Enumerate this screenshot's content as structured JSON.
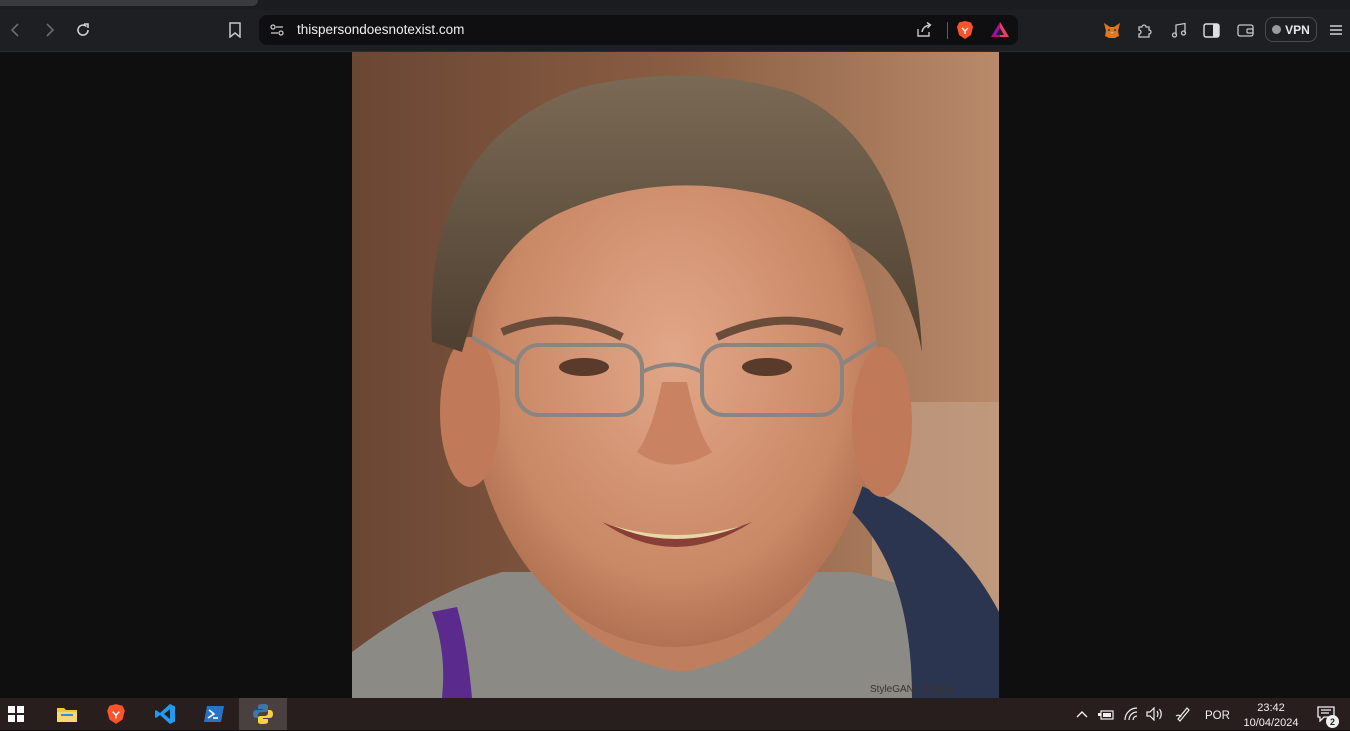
{
  "browser": {
    "address_bar": {
      "url": "thispersondoesnotexist.com"
    },
    "vpn_label": "VPN"
  },
  "page": {
    "image_credit": "StyleGAN2 (Karras"
  },
  "taskbar": {
    "language": "POR",
    "time": "23:42",
    "date": "10/04/2024",
    "notification_count": "2"
  },
  "colors": {
    "toolbar_bg": "#1e1f22",
    "page_bg": "#0f0f10",
    "taskbar_bg": "#281e1e",
    "brave_orange": "#fb542b",
    "vscode_blue": "#1f9cf0"
  }
}
